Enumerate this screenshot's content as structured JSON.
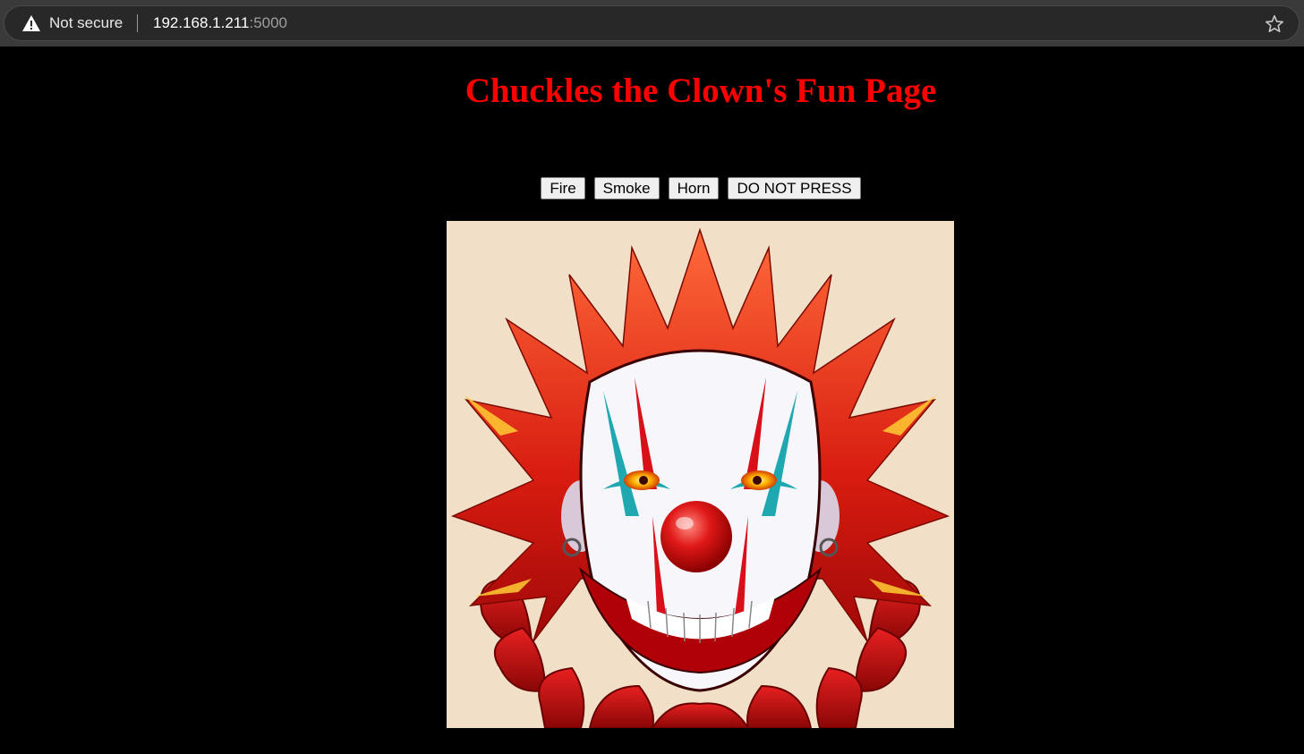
{
  "browser": {
    "security_label": "Not secure",
    "url_host": "192.168.1.211",
    "url_port": ":5000",
    "icons": {
      "warning": "warning-triangle-icon",
      "bookmark": "star-outline-icon"
    }
  },
  "page": {
    "title": "Chuckles the Clown's Fun Page",
    "title_color": "#ff0000",
    "background": "#000000",
    "buttons": [
      {
        "label": "Fire"
      },
      {
        "label": "Smoke"
      },
      {
        "label": "Horn"
      },
      {
        "label": "DO NOT PRESS"
      }
    ],
    "image": {
      "alt": "clown"
    }
  }
}
